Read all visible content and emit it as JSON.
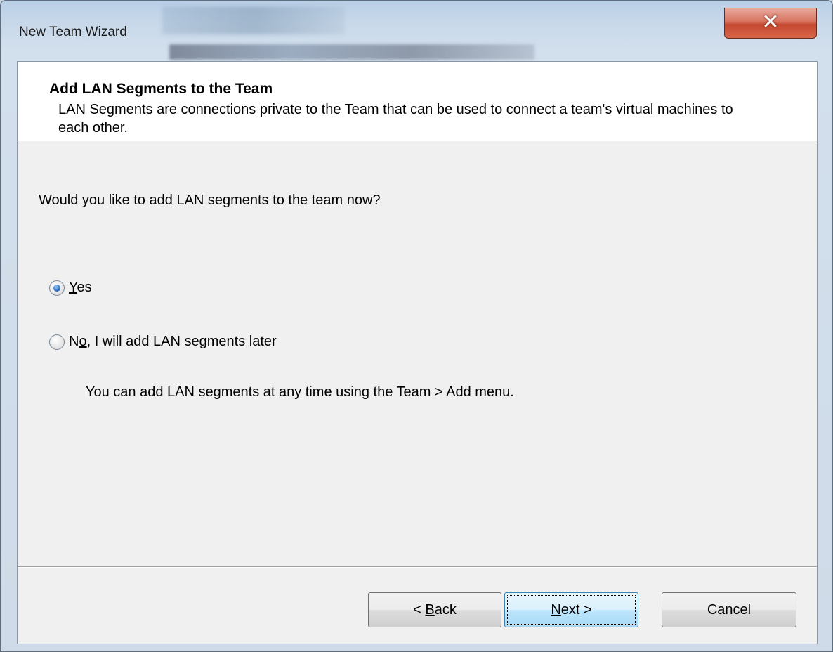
{
  "window": {
    "title": "New Team Wizard",
    "close_glyph": "✕"
  },
  "header": {
    "title": "Add LAN Segments to the Team",
    "description": "LAN Segments are connections private to the Team that can be used to connect a team's virtual machines to each other."
  },
  "main": {
    "question": "Would you like to add LAN segments to the team now?",
    "options": [
      {
        "mnemonic": "Y",
        "rest": "es",
        "prefix": "",
        "checked": true
      },
      {
        "prefix": "N",
        "mnemonic": "o",
        "rest": ", I will add LAN segments later",
        "checked": false
      }
    ],
    "hint": "You can add LAN segments at any time using the Team > Add menu."
  },
  "buttons": {
    "back": {
      "prefix": "< ",
      "mnemonic": "B",
      "rest": "ack"
    },
    "next": {
      "prefix": "",
      "mnemonic": "N",
      "rest": "ext >"
    },
    "cancel": {
      "label": "Cancel"
    }
  },
  "colors": {
    "close_button": "#c4482f",
    "default_button_border": "#3c7fb1",
    "radio_selected": "#2a6fc0"
  }
}
